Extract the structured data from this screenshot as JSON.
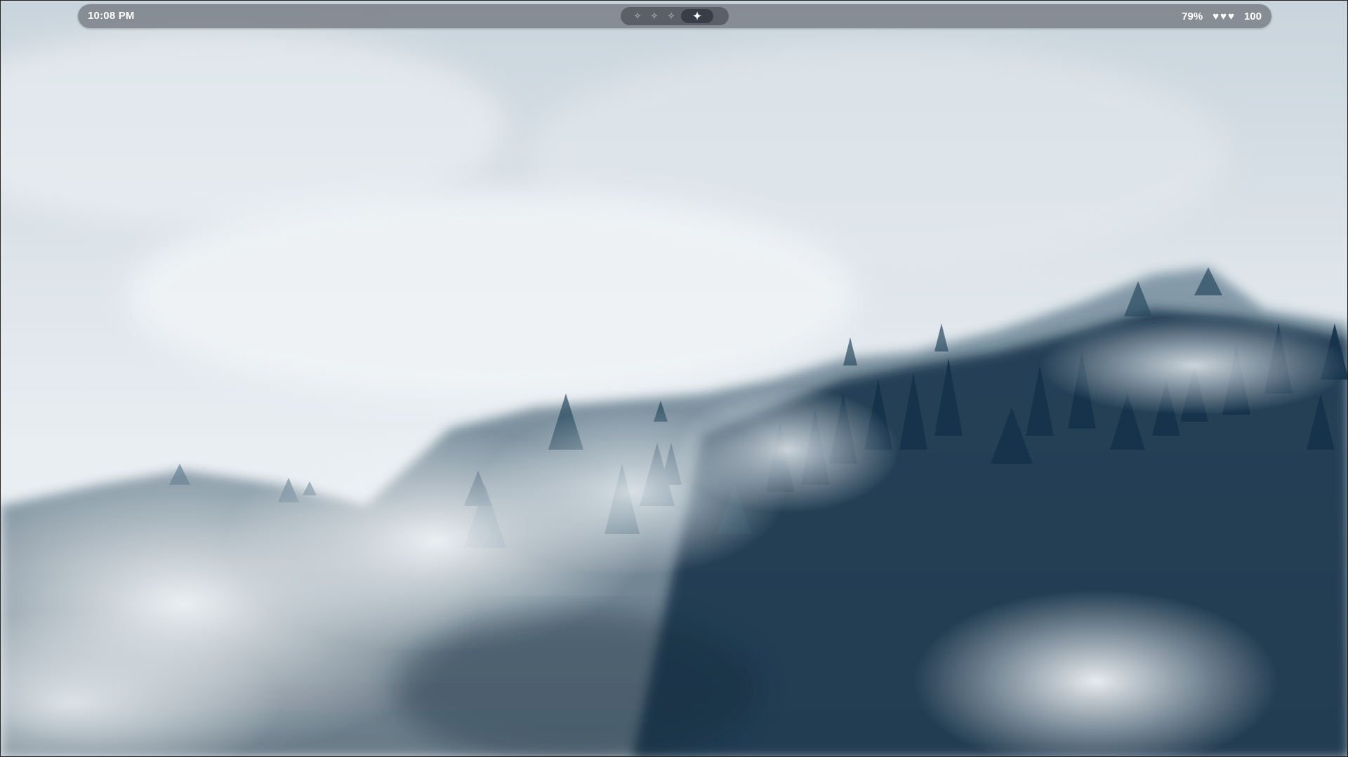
{
  "topbar": {
    "clock": "10:08 PM",
    "workspaces": [
      {
        "icon": "sparkle-icon",
        "glyph": "✧",
        "active": false
      },
      {
        "icon": "sparkle-icon",
        "glyph": "✧",
        "active": false
      },
      {
        "icon": "sparkle-icon",
        "glyph": "✧",
        "active": false
      },
      {
        "icon": "sparkle-icon",
        "glyph": "✦",
        "active": true
      }
    ],
    "battery_percent": "79%",
    "hearts": [
      "♥",
      "♥",
      "♥"
    ],
    "health_value": "100"
  },
  "colors": {
    "panel": "#787c84",
    "sky": "#d7dfe6",
    "forest_dark": "#123047"
  }
}
